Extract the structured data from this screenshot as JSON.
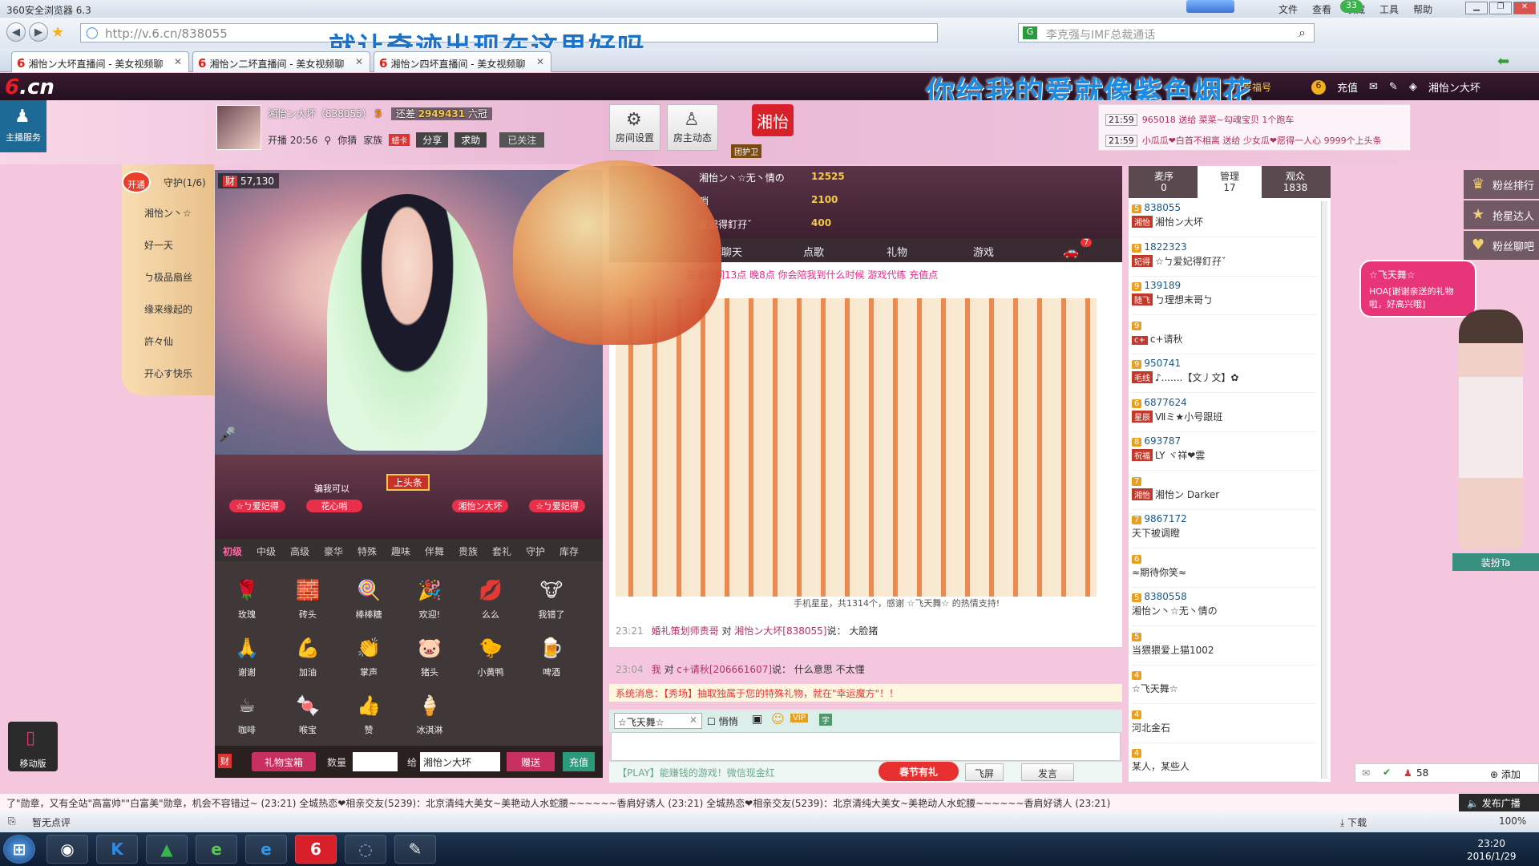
{
  "browser": {
    "title": "360安全浏览器 6.3",
    "url": "http://v.6.cn/838055",
    "search_placeholder": "李克强与IMF总裁通话",
    "menu": [
      "文件",
      "查看",
      "收藏",
      "工具",
      "帮助"
    ],
    "badge_count": "33",
    "tabs": [
      {
        "label": "湘怡ン大坏直播间 - 美女视频聊"
      },
      {
        "label": "湘怡ン二坏直播间 - 美女视频聊"
      },
      {
        "label": "湘怡ン四坏直播间 - 美女视频聊"
      }
    ]
  },
  "overlays": {
    "top_banner": "就让奇迹出现在这里好吗",
    "header_banner": "你给我的爱就像紫色烟花"
  },
  "site": {
    "logo_six": "6",
    "logo_cn": ".cn",
    "host_service": "主播服务",
    "recharge": "充值",
    "user_name": "湘怡ン大坏",
    "coin_label": "幸福号"
  },
  "room": {
    "host_name": "湘怡ン大坏（838055）",
    "host_level": "5",
    "gap_label": "还差",
    "gap_value": "2949431",
    "rank_label": "六冠",
    "open_time": "开播 20:56",
    "location": "你猜",
    "family_label": "家族",
    "family_tag": "蜡卡",
    "share": "分享",
    "help": "求助",
    "followed": "已关注",
    "room_settings": "房间设置",
    "host_feed": "房主动态",
    "badge": "湘怡",
    "guard_group": "团护卫"
  },
  "notices": [
    {
      "time": "21:59",
      "text": "965018 送给 菜菜~勾魂宝贝 1个跑车"
    },
    {
      "time": "21:59",
      "text": "小瓜瓜❤白首不相离 送给 少女瓜❤愿得一人心 9999个上头条"
    }
  ],
  "guard": {
    "open_label": "开通",
    "title": "守护(1/6)",
    "items": [
      "湘怡ン丶☆",
      "好一天",
      "ㄅ极品扇丝",
      "缘来缘起的",
      "許々仙",
      "开心す快乐"
    ]
  },
  "video": {
    "fortune": "57,130",
    "fortune_label": "财"
  },
  "seats": [
    {
      "name": "☆ㄅ爱妃得"
    },
    {
      "name": "花心哨"
    },
    {
      "name": "上头条"
    },
    {
      "name": "湘怡ン大坏"
    },
    {
      "name": "☆ㄅ爱妃得"
    }
  ],
  "seat_label": "骗我可以",
  "gift_tabs": [
    "初级",
    "中级",
    "高级",
    "豪华",
    "特殊",
    "趣味",
    "伴舞",
    "贵族",
    "套礼",
    "守护",
    "库存"
  ],
  "gifts": [
    {
      "name": "玫瑰",
      "icon": "🌹"
    },
    {
      "name": "砖头",
      "icon": "🧱"
    },
    {
      "name": "棒棒糖",
      "icon": "🍭"
    },
    {
      "name": "欢迎!",
      "icon": "🎉"
    },
    {
      "name": "么么",
      "icon": "💋"
    },
    {
      "name": "我错了",
      "icon": "🐮"
    },
    {
      "name": "谢谢",
      "icon": "🙏"
    },
    {
      "name": "加油",
      "icon": "💪"
    },
    {
      "name": "掌声",
      "icon": "👏"
    },
    {
      "name": "猪头",
      "icon": "🐷"
    },
    {
      "name": "小黄鸭",
      "icon": "🐤"
    },
    {
      "name": "啤酒",
      "icon": "🍺"
    },
    {
      "name": "咖啡",
      "icon": "☕"
    },
    {
      "name": "喉宝",
      "icon": "🍬"
    },
    {
      "name": "赞",
      "icon": "👍"
    },
    {
      "name": "冰淇淋",
      "icon": "🍦"
    }
  ],
  "giftbar": {
    "box": "礼物宝箱",
    "qty_label": "数量",
    "to_label": "给",
    "to_value": "湘怡ン大坏",
    "send": "赠送",
    "recharge": "充值",
    "fortune": "财"
  },
  "ranking": [
    {
      "name": "湘怡ン丶☆无丶情の",
      "value": "12525"
    },
    {
      "name": "哨",
      "value": "2100"
    },
    {
      "name": "爱妃得釘孖ˇ",
      "value": "400"
    }
  ],
  "chat_tabs": [
    "聊天",
    "点歌",
    "礼物",
    "游戏"
  ],
  "car_badge": "7",
  "chat_info": "直播时间13点 晚8点 你会陪我到什么时候 游戏代练 充值点",
  "gift_message": "手机星星，共1314个，感谢 ☆飞天舞☆ 的热情支持!",
  "chat_lines": [
    {
      "time": "23:21",
      "user": "婚礼策划师责哥",
      "to": "对",
      "target": "湘怡ン大坏[838055]",
      "said": "说：",
      "text": "大脸猪"
    },
    {
      "time": "23:04",
      "user": "我",
      "to": "对",
      "target": "c+请秋[206661607]",
      "said": "说：",
      "text": "什么意思 不太懂"
    }
  ],
  "system_message": "系统消息：【秀场】抽取独属于您的特殊礼物，就在\"幸运魔方\"！！",
  "input": {
    "target": "☆飞天舞☆",
    "whisper": "悄悄",
    "ad_text": "【PLAY】能赚钱的游戏！微信现金红",
    "spring": "春节有礼",
    "fly_screen": "飞屏",
    "send": "发言"
  },
  "user_tabs": [
    {
      "label": "麦序",
      "count": "0"
    },
    {
      "label": "管理",
      "count": "17"
    },
    {
      "label": "观众",
      "count": "1838"
    }
  ],
  "users": [
    {
      "level": "5",
      "id": "838055",
      "tag": "湘怡",
      "name": "湘怡ン大坏"
    },
    {
      "level": "9",
      "id": "1822323",
      "tag": "妃得",
      "name": "☆ㄅ爱妃得釘孖ˇ"
    },
    {
      "level": "9",
      "id": "139189",
      "tag": "随飞",
      "name": "ㄅ理想末哥ㄅ"
    },
    {
      "level": "9",
      "id": "",
      "tag": "c+",
      "name": "c+请秋"
    },
    {
      "level": "9",
      "id": "950741",
      "tag": "毛线",
      "name": "♪.......【文丿文】✿"
    },
    {
      "level": "6",
      "id": "6877624",
      "tag": "星辰",
      "name": "Ⅶミ★小号跟班"
    },
    {
      "level": "8",
      "id": "693787",
      "tag": "祝福",
      "name": "LY ヾ祥❤雲"
    },
    {
      "level": "7",
      "id": "",
      "tag": "湘怡",
      "name": "湘怡ン Darker"
    },
    {
      "level": "7",
      "id": "9867172",
      "tag": "",
      "name": "天下被调瞪"
    },
    {
      "level": "6",
      "id": "",
      "tag": "",
      "name": "≈期待你笑≈"
    },
    {
      "level": "5",
      "id": "8380558",
      "tag": "",
      "name": "湘怡ン丶☆无丶情の"
    },
    {
      "level": "5",
      "id": "",
      "tag": "",
      "name": "当猥猥爱上猫1002"
    },
    {
      "level": "4",
      "id": "",
      "tag": "",
      "name": "☆飞天舞☆"
    },
    {
      "level": "4",
      "id": "",
      "tag": "",
      "name": "河北金石"
    },
    {
      "level": "4",
      "id": "",
      "tag": "",
      "name": "某人，某些人"
    }
  ],
  "side_menu": [
    "粉丝排行",
    "抢星达人",
    "粉丝聊吧"
  ],
  "bubble": {
    "title": "☆飞天舞☆",
    "text": "HOA[谢谢亲送的礼物啦，好高兴哦]"
  },
  "dressup": "装扮Ta",
  "share_count": "58",
  "share_add": "添加",
  "mobile": "移动版",
  "marquee": "了\"勋章，又有全站\"高富帅\"\"白富美\"勋章，机会不容错过~ (23:21)    全城热恋❤相亲交友(5239)：北京清纯大美女~美艳动人水蛇腰~~~~~~香肩好诱人 (23:21)    全城热恋❤相亲交友(5239)：北京清纯大美女~美艳动人水蛇腰~~~~~~香肩好诱人 (23:21)",
  "broadcast": "发布广播",
  "status": {
    "left": "暂无点评",
    "download": "下载",
    "zoom": "100%"
  },
  "taskbar": {
    "time": "23:20",
    "date": "2016/1/29"
  }
}
